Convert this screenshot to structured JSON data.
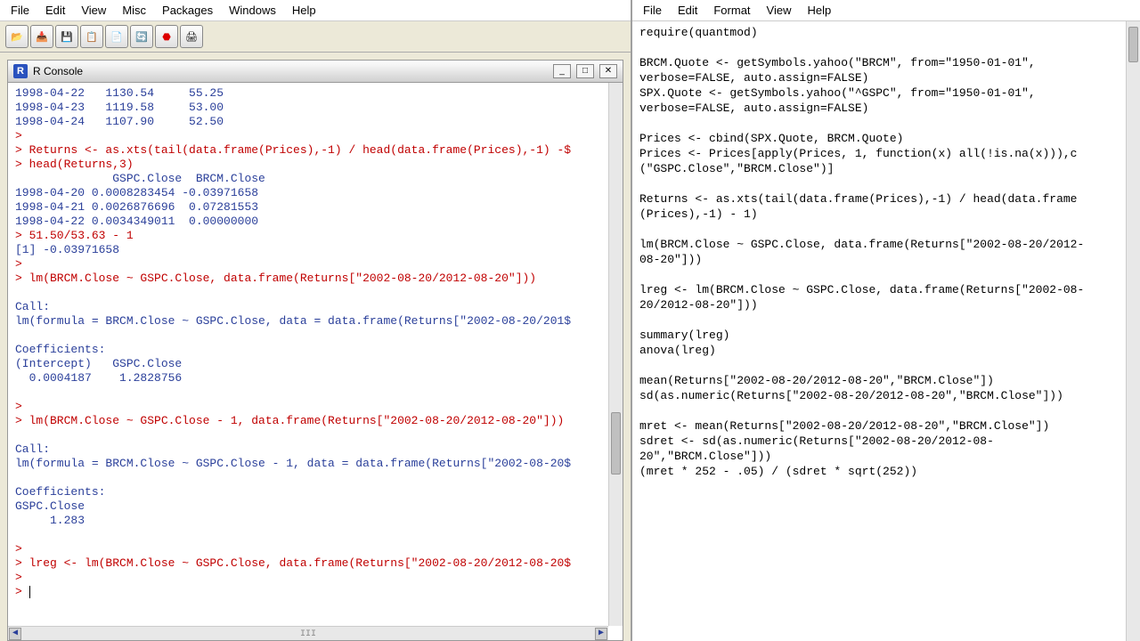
{
  "left": {
    "menu": [
      "File",
      "Edit",
      "View",
      "Misc",
      "Packages",
      "Windows",
      "Help"
    ],
    "toolbar": [
      "open",
      "import",
      "save",
      "copy",
      "paste",
      "refresh",
      "stop",
      "print"
    ],
    "console_title": "R Console",
    "lines": [
      {
        "t": "b",
        "v": "1998-04-22   1130.54     55.25"
      },
      {
        "t": "b",
        "v": "1998-04-23   1119.58     53.00"
      },
      {
        "t": "b",
        "v": "1998-04-24   1107.90     52.50"
      },
      {
        "t": "r",
        "v": "> "
      },
      {
        "t": "r",
        "v": "> Returns <- as.xts(tail(data.frame(Prices),-1) / head(data.frame(Prices),-1) -$"
      },
      {
        "t": "r",
        "v": "> head(Returns,3)"
      },
      {
        "t": "b",
        "v": "              GSPC.Close  BRCM.Close"
      },
      {
        "t": "b",
        "v": "1998-04-20 0.0008283454 -0.03971658"
      },
      {
        "t": "b",
        "v": "1998-04-21 0.0026876696  0.07281553"
      },
      {
        "t": "b",
        "v": "1998-04-22 0.0034349011  0.00000000"
      },
      {
        "t": "r",
        "v": "> 51.50/53.63 - 1"
      },
      {
        "t": "b",
        "v": "[1] -0.03971658"
      },
      {
        "t": "r",
        "v": "> "
      },
      {
        "t": "r",
        "v": "> lm(BRCM.Close ~ GSPC.Close, data.frame(Returns[\"2002-08-20/2012-08-20\"]))"
      },
      {
        "t": "b",
        "v": ""
      },
      {
        "t": "b",
        "v": "Call:"
      },
      {
        "t": "b",
        "v": "lm(formula = BRCM.Close ~ GSPC.Close, data = data.frame(Returns[\"2002-08-20/201$"
      },
      {
        "t": "b",
        "v": ""
      },
      {
        "t": "b",
        "v": "Coefficients:"
      },
      {
        "t": "b",
        "v": "(Intercept)   GSPC.Close"
      },
      {
        "t": "b",
        "v": "  0.0004187    1.2828756"
      },
      {
        "t": "b",
        "v": ""
      },
      {
        "t": "r",
        "v": "> "
      },
      {
        "t": "r",
        "v": "> lm(BRCM.Close ~ GSPC.Close - 1, data.frame(Returns[\"2002-08-20/2012-08-20\"]))"
      },
      {
        "t": "b",
        "v": ""
      },
      {
        "t": "b",
        "v": "Call:"
      },
      {
        "t": "b",
        "v": "lm(formula = BRCM.Close ~ GSPC.Close - 1, data = data.frame(Returns[\"2002-08-20$"
      },
      {
        "t": "b",
        "v": ""
      },
      {
        "t": "b",
        "v": "Coefficients:"
      },
      {
        "t": "b",
        "v": "GSPC.Close"
      },
      {
        "t": "b",
        "v": "     1.283"
      },
      {
        "t": "b",
        "v": ""
      },
      {
        "t": "r",
        "v": "> "
      },
      {
        "t": "r",
        "v": "> lreg <- lm(BRCM.Close ~ GSPC.Close, data.frame(Returns[\"2002-08-20/2012-08-20$"
      },
      {
        "t": "r",
        "v": "> "
      },
      {
        "t": "r",
        "v": "> "
      }
    ],
    "hscroll_label": "III"
  },
  "right": {
    "menu": [
      "File",
      "Edit",
      "Format",
      "View",
      "Help"
    ],
    "lines": [
      "require(quantmod)",
      "",
      "BRCM.Quote <- getSymbols.yahoo(\"BRCM\", from=\"1950-01-01\",",
      "verbose=FALSE, auto.assign=FALSE)",
      "SPX.Quote <- getSymbols.yahoo(\"^GSPC\", from=\"1950-01-01\",",
      "verbose=FALSE, auto.assign=FALSE)",
      "",
      "Prices <- cbind(SPX.Quote, BRCM.Quote)",
      "Prices <- Prices[apply(Prices, 1, function(x) all(!is.na(x))),c",
      "(\"GSPC.Close\",\"BRCM.Close\")]",
      "",
      "Returns <- as.xts(tail(data.frame(Prices),-1) / head(data.frame",
      "(Prices),-1) - 1)",
      "",
      "lm(BRCM.Close ~ GSPC.Close, data.frame(Returns[\"2002-08-20/2012-",
      "08-20\"]))",
      "",
      "lreg <- lm(BRCM.Close ~ GSPC.Close, data.frame(Returns[\"2002-08-",
      "20/2012-08-20\"]))",
      "",
      "summary(lreg)",
      "anova(lreg)",
      "",
      "mean(Returns[\"2002-08-20/2012-08-20\",\"BRCM.Close\"])",
      "sd(as.numeric(Returns[\"2002-08-20/2012-08-20\",\"BRCM.Close\"]))",
      "",
      "mret <- mean(Returns[\"2002-08-20/2012-08-20\",\"BRCM.Close\"])",
      "sdret <- sd(as.numeric(Returns[\"2002-08-20/2012-08-",
      "20\",\"BRCM.Close\"]))",
      "(mret * 252 - .05) / (sdret * sqrt(252))"
    ]
  }
}
